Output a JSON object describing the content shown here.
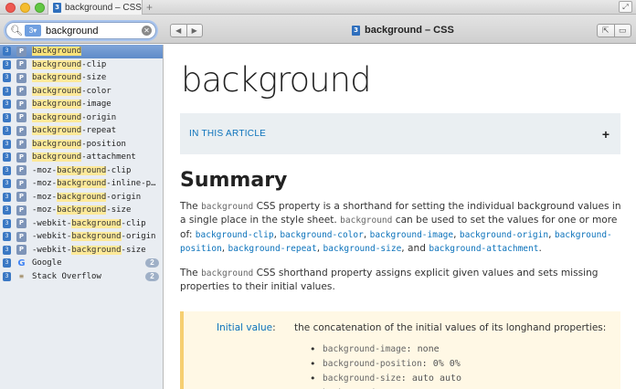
{
  "window": {
    "tab_title": "background – CSS",
    "tab_add": "+"
  },
  "toolbar": {
    "search_value": "background",
    "scope_icon": "docset-scope-icon",
    "back": "◀",
    "forward": "▶",
    "doc_title": "background – CSS",
    "share": "⇱",
    "bookmark": "📖"
  },
  "sidebar": {
    "items": [
      {
        "pre": "",
        "match": "background",
        "post": "",
        "type": "P",
        "selected": true
      },
      {
        "pre": "",
        "match": "background",
        "post": "-clip",
        "type": "P"
      },
      {
        "pre": "",
        "match": "background",
        "post": "-size",
        "type": "P"
      },
      {
        "pre": "",
        "match": "background",
        "post": "-color",
        "type": "P"
      },
      {
        "pre": "",
        "match": "background",
        "post": "-image",
        "type": "P"
      },
      {
        "pre": "",
        "match": "background",
        "post": "-origin",
        "type": "P"
      },
      {
        "pre": "",
        "match": "background",
        "post": "-repeat",
        "type": "P"
      },
      {
        "pre": "",
        "match": "background",
        "post": "-position",
        "type": "P"
      },
      {
        "pre": "",
        "match": "background",
        "post": "-attachment",
        "type": "P"
      },
      {
        "pre": "-moz-",
        "match": "background",
        "post": "-clip",
        "type": "P"
      },
      {
        "pre": "-moz-",
        "match": "background",
        "post": "-inline-p…",
        "type": "P"
      },
      {
        "pre": "-moz-",
        "match": "background",
        "post": "-origin",
        "type": "P"
      },
      {
        "pre": "-moz-",
        "match": "background",
        "post": "-size",
        "type": "P"
      },
      {
        "pre": "-webkit-",
        "match": "background",
        "post": "-clip",
        "type": "P"
      },
      {
        "pre": "-webkit-",
        "match": "background",
        "post": "-origin",
        "type": "P"
      },
      {
        "pre": "-webkit-",
        "match": "background",
        "post": "-size",
        "type": "P"
      }
    ],
    "google": {
      "label": "Google",
      "count": "2"
    },
    "stackoverflow": {
      "label": "Stack Overflow",
      "count": "2"
    }
  },
  "content": {
    "heading": "background",
    "in_this_article": "IN THIS ARTICLE",
    "expand": "+",
    "summary": "Summary",
    "p1": {
      "t1": "The ",
      "c1": "background",
      "t2": " CSS property is a shorthand for setting the individual background values in a single place in the style sheet. ",
      "c2": "background",
      "t3": " can be used to set the values for one or more of: ",
      "links": [
        "background-clip",
        "background-color",
        "background-image",
        "background-origin",
        "background-position",
        "background-repeat",
        "background-size",
        "background-attachment"
      ],
      "and": "and",
      "end": "."
    },
    "p2": {
      "t1": "The ",
      "c1": "background",
      "t2": " CSS shorthand property assigns explicit given values and sets missing properties to their initial values."
    },
    "info": {
      "label": "Initial value",
      "colon": ":",
      "value": "the concatenation of the initial values of its longhand properties:",
      "items": [
        {
          "prop": "background-image",
          "val": "none"
        },
        {
          "prop": "background-position",
          "val": "0% 0%"
        },
        {
          "prop": "background-size",
          "val": "auto auto"
        },
        {
          "prop": "background-repeat",
          "val": "repeat"
        }
      ]
    }
  },
  "colors": {
    "link": "#0b72bb",
    "selection": "#6b93cd",
    "highlight": "#fde999",
    "info_border": "#f6cf72"
  }
}
